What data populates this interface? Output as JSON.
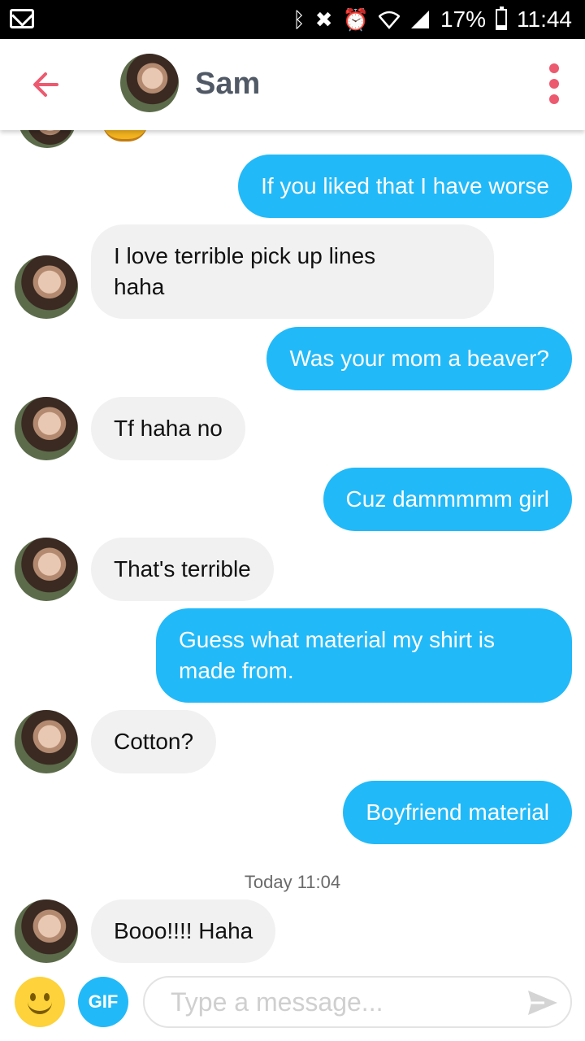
{
  "status_bar": {
    "battery_text": "17%",
    "battery_level": 0.17,
    "time": "11:44",
    "icons": [
      "mail-icon",
      "bluetooth-icon",
      "mute-icon",
      "alarm-icon",
      "wifi-icon",
      "signal-icon",
      "battery-icon"
    ]
  },
  "header": {
    "contact_name": "Sam",
    "back_icon": "back-arrow-icon",
    "menu_icon": "kebab-menu-icon",
    "accent_color": "#ec5a6f"
  },
  "colors": {
    "sent_bubble": "#22b9f8",
    "received_bubble": "#f1f1f1"
  },
  "messages": [
    {
      "sender": "me",
      "text": "If you liked that I have worse"
    },
    {
      "sender": "Sam",
      "text": "I love terrible pick up lines\nhaha"
    },
    {
      "sender": "me",
      "text": "Was your mom a beaver?"
    },
    {
      "sender": "Sam",
      "text": "Tf haha no"
    },
    {
      "sender": "me",
      "text": "Cuz dammmmm girl"
    },
    {
      "sender": "Sam",
      "text": "That's terrible"
    },
    {
      "sender": "me",
      "text": "Guess what material my shirt is\nmade from."
    },
    {
      "sender": "Sam",
      "text": "Cotton?"
    },
    {
      "sender": "me",
      "text": "Boyfriend material"
    },
    {
      "sender": "Sam",
      "text": "Booo!!!! Haha"
    }
  ],
  "timestamp": {
    "day": "Today",
    "time": "11:04"
  },
  "composer": {
    "gif_label": "GIF",
    "placeholder": "Type a message...",
    "send_icon": "send-icon",
    "emoji_icon": "emoji-icon"
  }
}
